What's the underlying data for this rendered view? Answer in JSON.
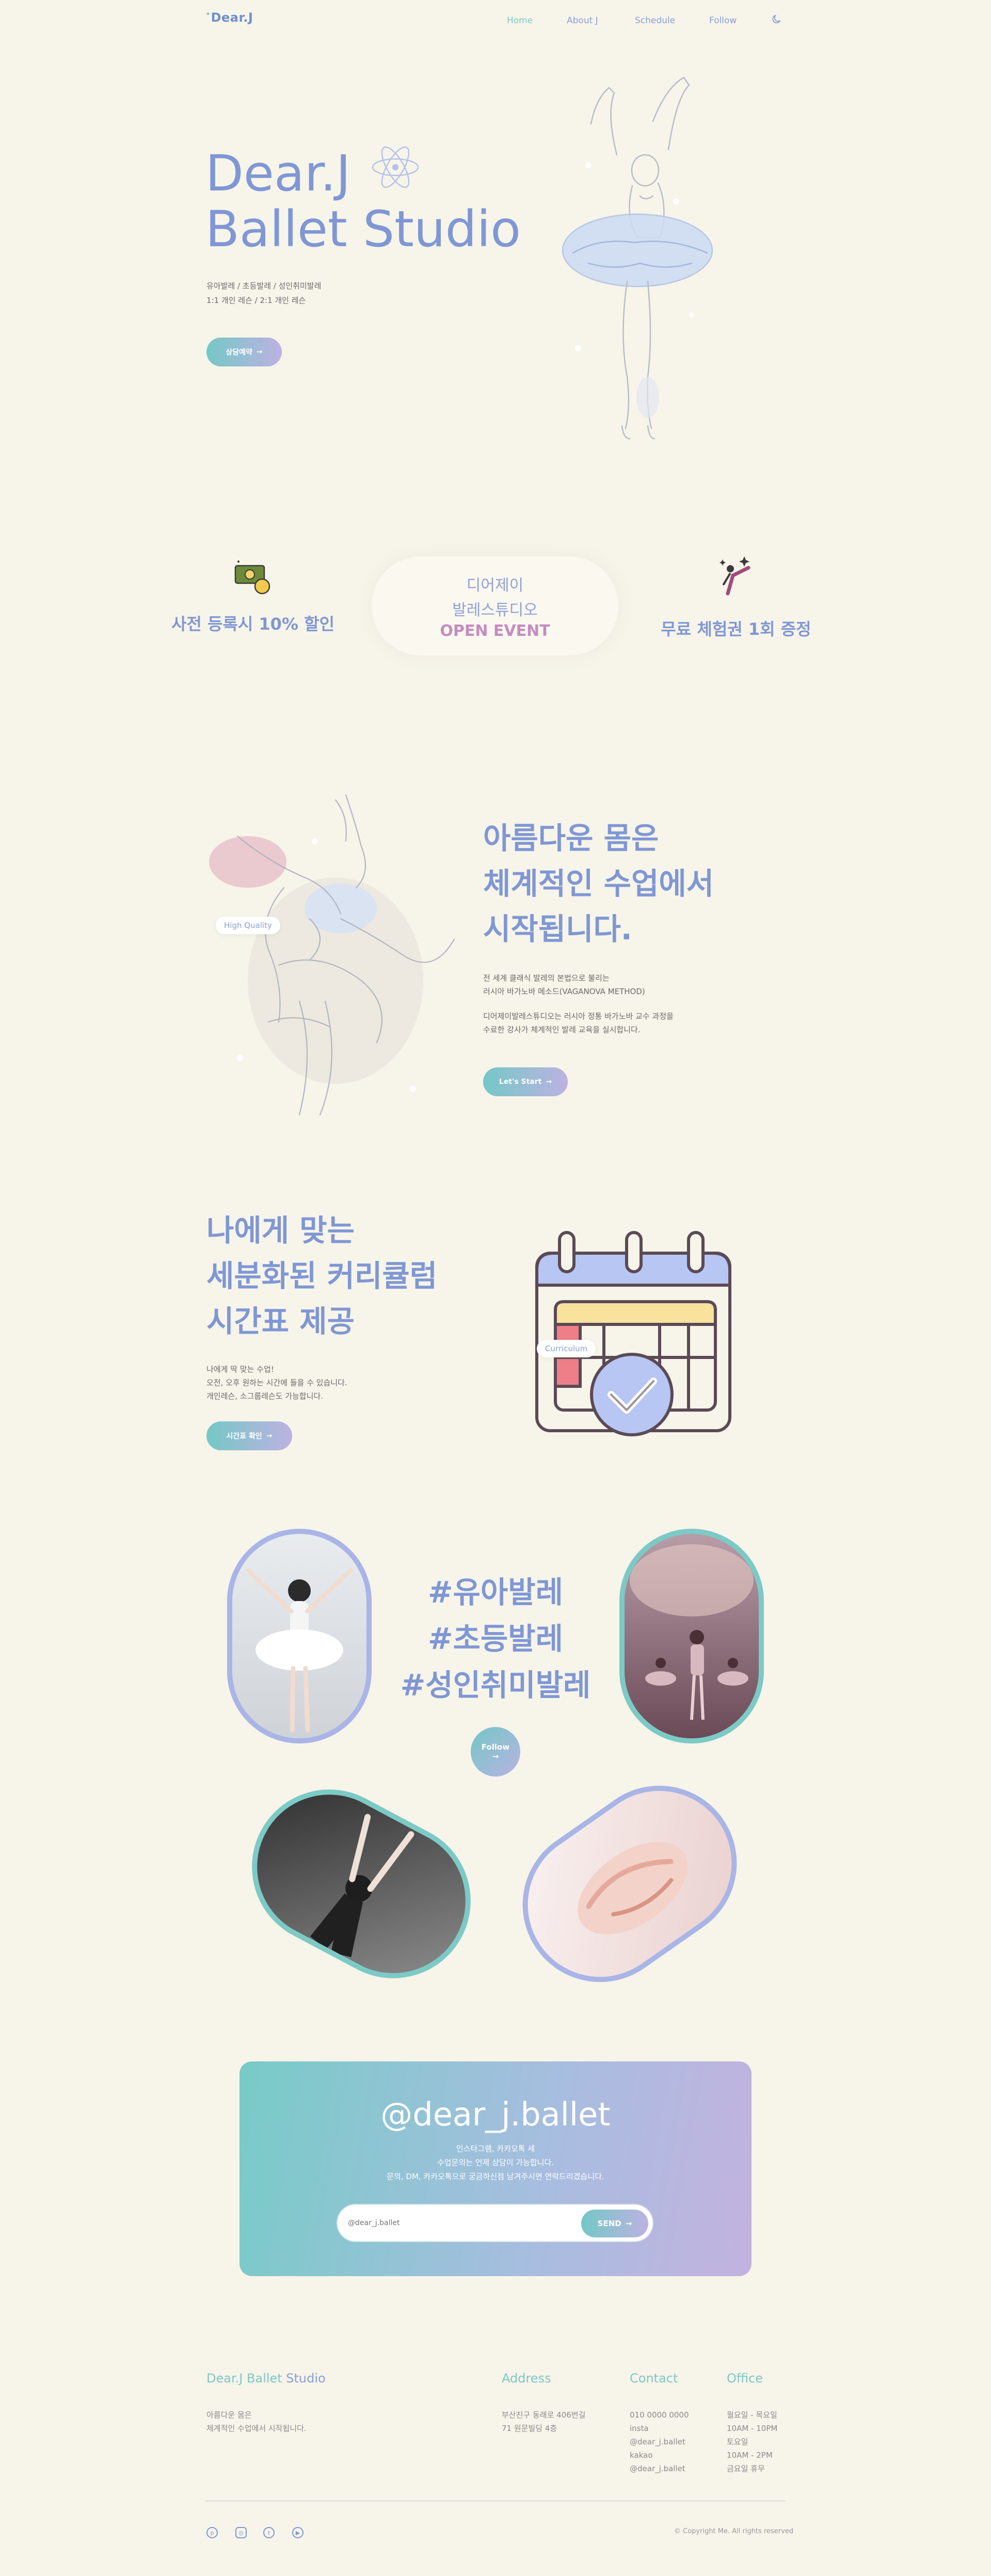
{
  "nav": {
    "logo": "Dear.J",
    "items": [
      "Home",
      "About J",
      "Schedule",
      "Follow"
    ],
    "theme_toggle": "moon-icon"
  },
  "hero": {
    "title_line1": "Dear.J",
    "title_line2": "Ballet Studio",
    "desc_line1": "유아발레 / 초등발레 / 성인취미발레",
    "desc_line2": "1:1 개인 레슨 / 2:1 개인 레슨",
    "button": "상담예약"
  },
  "event": {
    "left": "사전 등록시 10% 할인",
    "center_line1": "디어제이",
    "center_line2": "발레스튜디오",
    "center_line3": "OPEN EVENT",
    "right": "무료 체험권 1회 증정"
  },
  "quality": {
    "tag": "High Quality",
    "heading_line1": "아름다운 몸은",
    "heading_line2": "체계적인 수업에서",
    "heading_line3": "시작됩니다.",
    "p1_line1": "전 세계 클래식 발레의 본법으로 불리는",
    "p1_line2": "러시아 바가노바 메소드(VAGANOVA METHOD)",
    "p2_line1": "디어제이발레스튜디오는 러시아 정통 바가노바 교수 과정을",
    "p2_line2": "수료한 강사가 체계적인 발레 교육을 실시합니다.",
    "button": "Let's Start"
  },
  "curriculum": {
    "tag": "Curriculum",
    "heading_line1": "나에게 맞는",
    "heading_line2": "세분화된 커리큘럼",
    "heading_line3": "시간표 제공",
    "p_line1": "나에게 딱 맞는 수업!",
    "p_line2": "오전, 오후 원하는 시간에 들을 수 있습니다.",
    "p_line3": "개인레슨, 소그룹레슨도 가능합니다.",
    "button": "시간표 확인"
  },
  "hashtags": {
    "tag1": "#유아발레",
    "tag2": "#초등발레",
    "tag3": "#성인취미발레",
    "follow": "Follow"
  },
  "instagram": {
    "handle": "@dear_j.ballet",
    "desc_line1": "인스타그램, 카카오톡 세",
    "desc_line2": "수업문의는 언제 상담이 가능합니다.",
    "desc_line3": "문의, DM, 카카오톡으로 궁금하신점 남겨주시면 연락드리겠습니다.",
    "input_placeholder": "@dear_j.ballet",
    "send": "SEND"
  },
  "footer": {
    "brand_a": "Dear.J Ballet",
    "brand_b": " Studio",
    "brand_line1": "아름다운 몸은",
    "brand_line2": "체계적인 수업에서 시작됩니다.",
    "address_title": "Address",
    "address_line1": "부산진구 동래로 406번길",
    "address_line2": "71 원문빌딩 4층",
    "contact_title": "Contact",
    "contact_lines": [
      "010 0000 0000",
      "insta",
      "@dear_j.ballet",
      "kakao",
      "@dear_j.ballet"
    ],
    "office_title": "Office",
    "office_lines": [
      "월요일 - 목요일",
      "10AM - 10PM",
      "토요일",
      "10AM - 2PM",
      "금요일 휴무"
    ],
    "copyright": "© Copyright Me. All rights reserved"
  }
}
